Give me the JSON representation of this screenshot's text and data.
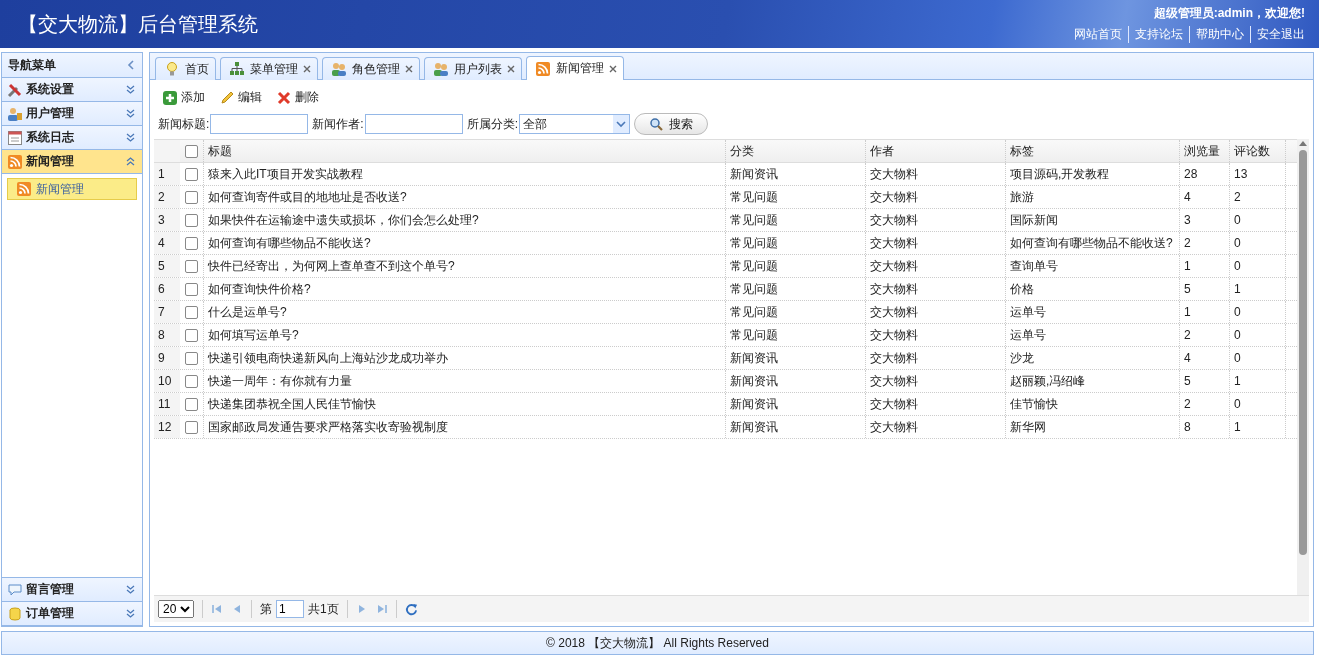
{
  "header": {
    "title": "【交大物流】后台管理系统",
    "greeting": "超级管理员:admin，欢迎您!",
    "links": [
      "网站首页",
      "支持论坛",
      "帮助中心",
      "安全退出"
    ]
  },
  "sidebar": {
    "title": "导航菜单",
    "items": [
      {
        "label": "系统设置",
        "expanded": false
      },
      {
        "label": "用户管理",
        "expanded": false
      },
      {
        "label": "系统日志",
        "expanded": false
      },
      {
        "label": "新闻管理",
        "expanded": true,
        "children": [
          {
            "label": "新闻管理",
            "selected": true
          }
        ]
      },
      {
        "label": "留言管理",
        "expanded": false
      },
      {
        "label": "订单管理",
        "expanded": false
      }
    ]
  },
  "tabs": [
    {
      "label": "首页",
      "closable": false,
      "selected": false
    },
    {
      "label": "菜单管理",
      "closable": true,
      "selected": false
    },
    {
      "label": "角色管理",
      "closable": true,
      "selected": false
    },
    {
      "label": "用户列表",
      "closable": true,
      "selected": false
    },
    {
      "label": "新闻管理",
      "closable": true,
      "selected": true
    }
  ],
  "toolbar": [
    "添加",
    "编辑",
    "删除"
  ],
  "search": {
    "fields": [
      {
        "label": "新闻标题:",
        "kind": "text"
      },
      {
        "label": "新闻作者:",
        "kind": "text"
      },
      {
        "label": "所属分类:",
        "kind": "combo",
        "value": "全部"
      }
    ],
    "button": "搜索"
  },
  "table": {
    "header_checked": false,
    "columns": [
      "标题",
      "分类",
      "作者",
      "标签",
      "浏览量",
      "评论数"
    ],
    "rows": [
      {
        "n": "1",
        "checked": false,
        "cells": [
          "猿来入此IT项目开发实战教程",
          "新闻资讯",
          "交大物料",
          "项目源码,开发教程",
          "28",
          "13"
        ]
      },
      {
        "n": "2",
        "checked": false,
        "cells": [
          "如何查询寄件或目的地地址是否收送?",
          "常见问题",
          "交大物料",
          "旅游",
          "4",
          "2"
        ]
      },
      {
        "n": "3",
        "checked": false,
        "cells": [
          "如果快件在运输途中遗失或损坏，你们会怎么处理?",
          "常见问题",
          "交大物料",
          "国际新闻",
          "3",
          "0"
        ]
      },
      {
        "n": "4",
        "checked": false,
        "cells": [
          "如何查询有哪些物品不能收送?",
          "常见问题",
          "交大物料",
          "如何查询有哪些物品不能收送?",
          "2",
          "0"
        ]
      },
      {
        "n": "5",
        "checked": false,
        "cells": [
          "快件已经寄出，为何网上查单查不到这个单号?",
          "常见问题",
          "交大物料",
          "查询单号",
          "1",
          "0"
        ]
      },
      {
        "n": "6",
        "checked": false,
        "cells": [
          "如何查询快件价格?",
          "常见问题",
          "交大物料",
          "价格",
          "5",
          "1"
        ]
      },
      {
        "n": "7",
        "checked": false,
        "cells": [
          "什么是运单号?",
          "常见问题",
          "交大物料",
          "运单号",
          "1",
          "0"
        ]
      },
      {
        "n": "8",
        "checked": false,
        "cells": [
          "如何填写运单号?",
          "常见问题",
          "交大物料",
          "运单号",
          "2",
          "0"
        ]
      },
      {
        "n": "9",
        "checked": false,
        "cells": [
          "快递引领电商快递新风向上海站沙龙成功举办",
          "新闻资讯",
          "交大物料",
          "沙龙",
          "4",
          "0"
        ]
      },
      {
        "n": "10",
        "checked": false,
        "cells": [
          "快递一周年：有你就有力量",
          "新闻资讯",
          "交大物料",
          "赵丽颖,冯绍峰",
          "5",
          "1"
        ]
      },
      {
        "n": "11",
        "checked": false,
        "cells": [
          "快递集团恭祝全国人民佳节愉快",
          "新闻资讯",
          "交大物料",
          "佳节愉快",
          "2",
          "0"
        ]
      },
      {
        "n": "12",
        "checked": false,
        "cells": [
          "国家邮政局发通告要求严格落实收寄验视制度",
          "新闻资讯",
          "交大物料",
          "新华网",
          "8",
          "1"
        ]
      }
    ]
  },
  "pager": {
    "page_size": "20",
    "before_page": "第",
    "page": "1",
    "total_pages": "共1页"
  },
  "footer": "© 2018 【交大物流】 All Rights Reserved"
}
